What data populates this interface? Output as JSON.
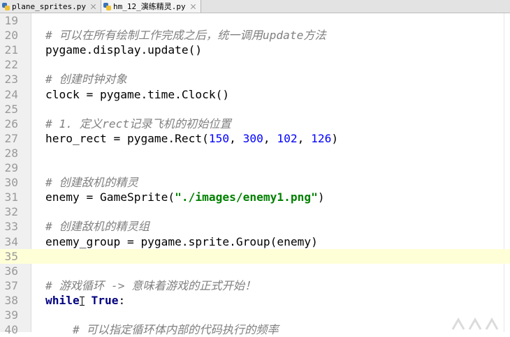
{
  "tabs": [
    {
      "label": "plane_sprites.py",
      "active": false
    },
    {
      "label": "hm_12_演练精灵.py",
      "active": true
    }
  ],
  "code_lines": [
    {
      "num": "19",
      "parts": []
    },
    {
      "num": "20",
      "parts": [
        {
          "t": "# 可以在所有绘制工作完成之后，统一调用update方法",
          "c": "cm"
        }
      ]
    },
    {
      "num": "21",
      "parts": [
        {
          "t": "pygame.display.update()",
          "c": ""
        }
      ]
    },
    {
      "num": "22",
      "parts": []
    },
    {
      "num": "23",
      "parts": [
        {
          "t": "# 创建时钟对象",
          "c": "cm"
        }
      ]
    },
    {
      "num": "24",
      "parts": [
        {
          "t": "clock = pygame.time.Clock()",
          "c": ""
        }
      ]
    },
    {
      "num": "25",
      "parts": []
    },
    {
      "num": "26",
      "parts": [
        {
          "t": "# 1. 定义rect记录飞机的初始位置",
          "c": "cm"
        }
      ]
    },
    {
      "num": "27",
      "parts": [
        {
          "t": "hero_rect = pygame.Rect(",
          "c": ""
        },
        {
          "t": "150",
          "c": "num-lit"
        },
        {
          "t": ", ",
          "c": ""
        },
        {
          "t": "300",
          "c": "num-lit"
        },
        {
          "t": ", ",
          "c": ""
        },
        {
          "t": "102",
          "c": "num-lit"
        },
        {
          "t": ", ",
          "c": ""
        },
        {
          "t": "126",
          "c": "num-lit"
        },
        {
          "t": ")",
          "c": ""
        }
      ]
    },
    {
      "num": "28",
      "parts": []
    },
    {
      "num": "29",
      "parts": []
    },
    {
      "num": "30",
      "parts": [
        {
          "t": "# 创建敌机的精灵",
          "c": "cm"
        }
      ]
    },
    {
      "num": "31",
      "parts": [
        {
          "t": "enemy = GameSprite(",
          "c": ""
        },
        {
          "t": "\"./images/enemy1.png\"",
          "c": "str"
        },
        {
          "t": ")",
          "c": ""
        }
      ]
    },
    {
      "num": "32",
      "parts": []
    },
    {
      "num": "33",
      "parts": [
        {
          "t": "# 创建敌机的精灵组",
          "c": "cm"
        }
      ]
    },
    {
      "num": "34",
      "parts": [
        {
          "t": "enemy_group = pygame.sprite.Group(enemy)",
          "c": ""
        }
      ]
    },
    {
      "num": "35",
      "parts": [],
      "current": true
    },
    {
      "num": "36",
      "parts": []
    },
    {
      "num": "37",
      "parts": [
        {
          "t": "# 游戏循环 -> 意味着游戏的正式开始！",
          "c": "cm"
        }
      ]
    },
    {
      "num": "38",
      "parts": [
        {
          "t": "while",
          "c": "kw"
        },
        {
          "t": "",
          "c": "ibeam"
        },
        {
          "t": " True",
          "c": "kw"
        },
        {
          "t": ":",
          "c": ""
        }
      ]
    },
    {
      "num": "39",
      "parts": []
    },
    {
      "num": "40",
      "parts": [
        {
          "t": "    # 可以指定循环体内部的代码执行的频率",
          "c": "cm"
        }
      ]
    }
  ],
  "colors": {
    "comment": "#808080",
    "string": "#008000",
    "number": "#0000ff",
    "keyword": "#000080",
    "current_line": "#ffffd7"
  }
}
